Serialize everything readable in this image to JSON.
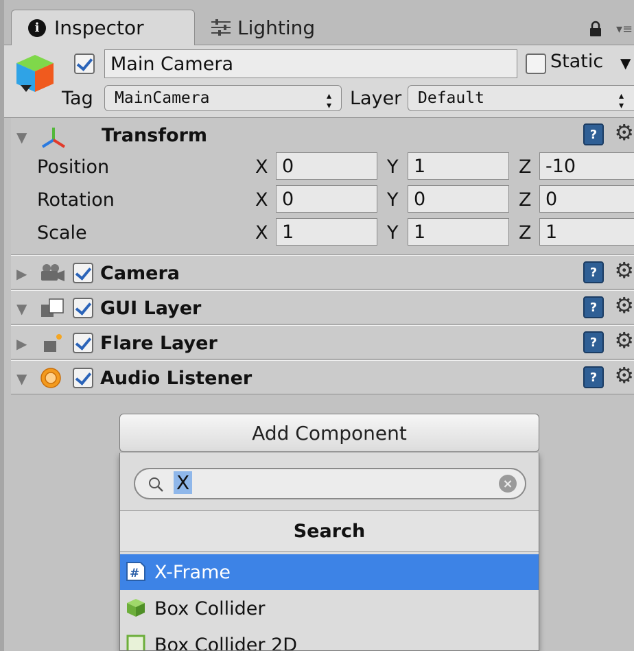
{
  "tabs": [
    {
      "label": "Inspector",
      "icon": "info-icon",
      "active": true
    },
    {
      "label": "Lighting",
      "icon": "lighting-icon",
      "active": false
    }
  ],
  "game_object": {
    "name": "Main Camera",
    "active": true,
    "static_label": "Static",
    "static_checked": false,
    "tag_label": "Tag",
    "tag_value": "MainCamera",
    "layer_label": "Layer",
    "layer_value": "Default"
  },
  "transform": {
    "title": "Transform",
    "rows": [
      {
        "label": "Position",
        "x": "0",
        "y": "1",
        "z": "-10"
      },
      {
        "label": "Rotation",
        "x": "0",
        "y": "0",
        "z": "0"
      },
      {
        "label": "Scale",
        "x": "1",
        "y": "1",
        "z": "1"
      }
    ],
    "axis_x": "X",
    "axis_y": "Y",
    "axis_z": "Z"
  },
  "components": [
    {
      "title": "Camera",
      "icon": "camera-icon",
      "enabled": true,
      "expanded": false
    },
    {
      "title": "GUI Layer",
      "icon": "gui-layer-icon",
      "enabled": true,
      "expanded": true
    },
    {
      "title": "Flare Layer",
      "icon": "flare-layer-icon",
      "enabled": true,
      "expanded": false
    },
    {
      "title": "Audio Listener",
      "icon": "audio-listener-icon",
      "enabled": true,
      "expanded": true
    }
  ],
  "add_component": {
    "button_label": "Add Component",
    "search_value": "X",
    "search_header": "Search",
    "results": [
      {
        "label": "X-Frame",
        "icon": "csharp-script-icon",
        "selected": true
      },
      {
        "label": "Box Collider",
        "icon": "box-collider-icon",
        "selected": false
      },
      {
        "label": "Box Collider 2D",
        "icon": "box-collider-2d-icon",
        "selected": false
      }
    ]
  },
  "colors": {
    "selection": "#3d83e6",
    "help_icon": "#2f5f95",
    "audio_icon": "#f39a1e"
  }
}
